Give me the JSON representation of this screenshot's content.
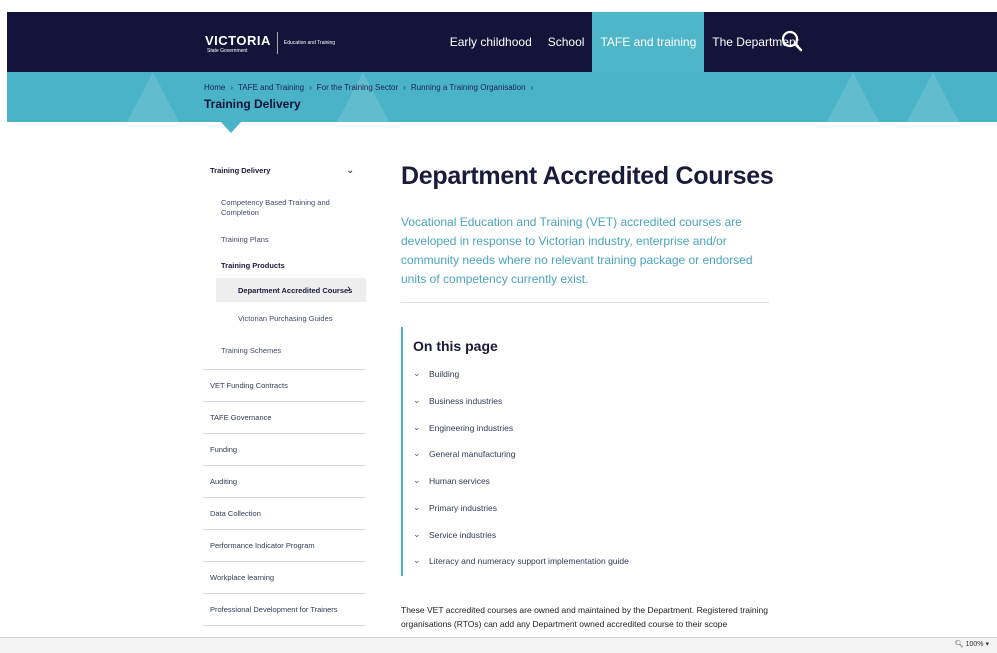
{
  "header": {
    "logo": {
      "word": "VICTORIA",
      "sub": "State Government",
      "dept": "Education and Training"
    },
    "nav": [
      "Early childhood",
      "School",
      "TAFE and training",
      "The Department"
    ],
    "active_nav": "TAFE and training",
    "search_icon": "search-icon"
  },
  "breadcrumb": {
    "items": [
      "Home",
      "TAFE and Training",
      "For the Training Sector",
      "Running a Training Organisation"
    ],
    "title": "Training Delivery"
  },
  "sidebar": {
    "heading": "Training Delivery",
    "items": {
      "competency": "Competency Based Training and Completion",
      "plans": "Training Plans",
      "products": "Training Products",
      "accredited": "Department Accredited Courses",
      "purchasing": "Victorian Purchasing Guides",
      "schemes": "Training Schemes"
    },
    "sections": [
      "VET Funding Contracts",
      "TAFE Governance",
      "Funding",
      "Auditing",
      "Data Collection",
      "Performance Indicator Program",
      "Workplace learning",
      "Professional Development for Trainers"
    ]
  },
  "main": {
    "title": "Department Accredited Courses",
    "lead": "Vocational Education and Training (VET) accredited courses are developed in response to Victorian industry, enterprise and/or community needs where no relevant training package or endorsed units of competency currently exist.",
    "on_this_page": {
      "title": "On this page",
      "items": [
        "Building",
        "Business industries",
        "Engineering industries",
        "General manufacturing",
        "Human services",
        "Primary industries",
        "Service industries",
        "Literacy and numeracy support implementation guide"
      ]
    },
    "paragraph": "These VET accredited courses are owned and maintained by the Department. Registered training organisations (RTOs) can add any Department owned accredited course to their scope"
  },
  "statusbar": {
    "zoom": "100%"
  },
  "colors": {
    "navy": "#14133a",
    "teal": "#4ab3c8",
    "lead_text": "#4aa4bd"
  }
}
